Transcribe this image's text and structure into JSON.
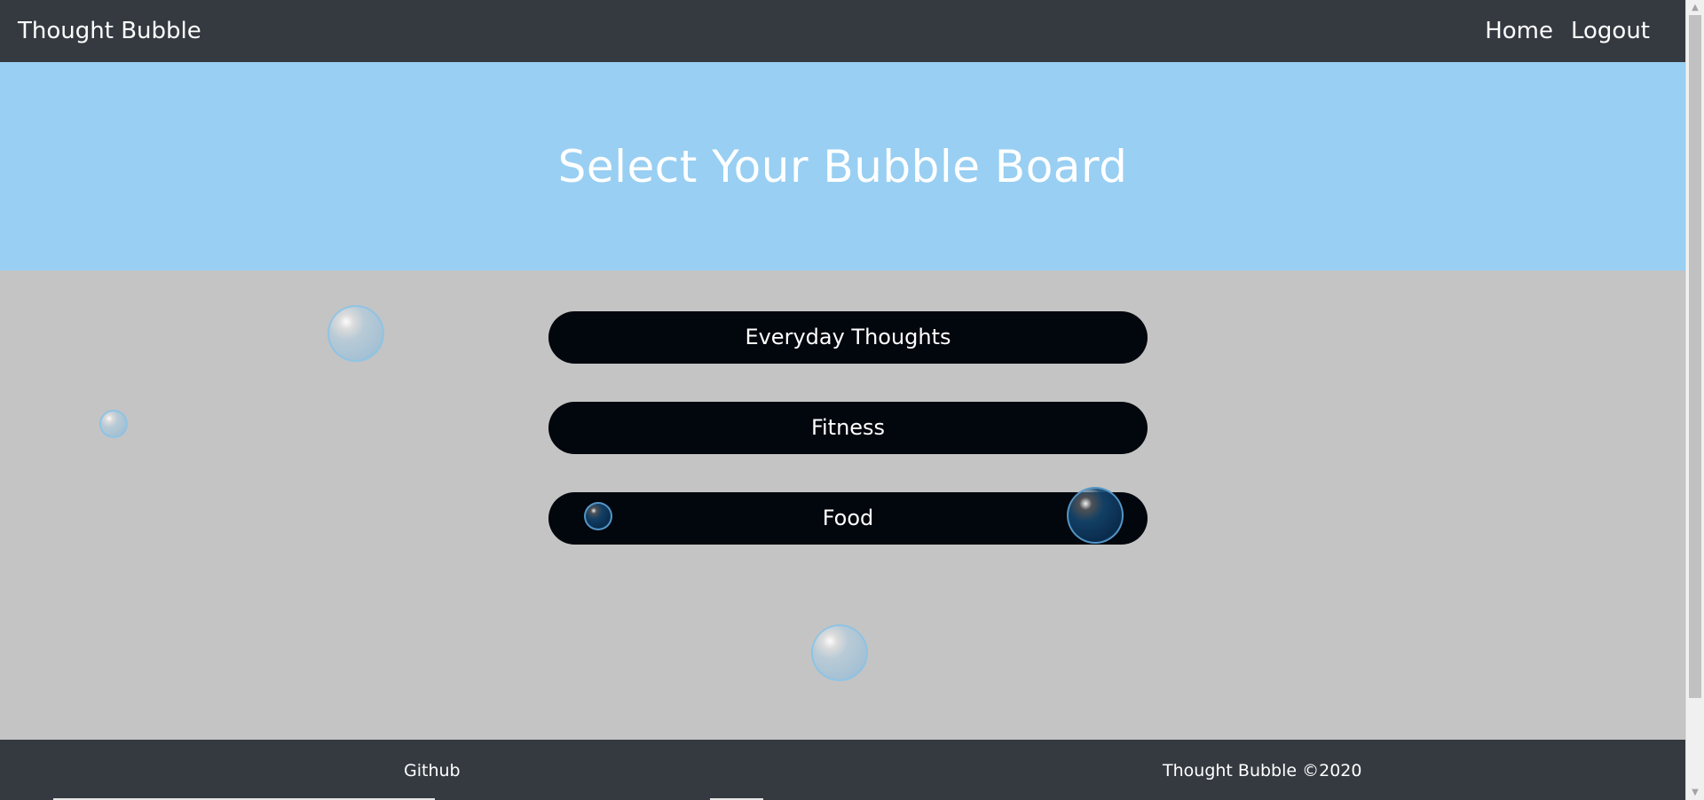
{
  "navbar": {
    "brand": "Thought Bubble",
    "links": [
      "Home",
      "Logout"
    ]
  },
  "hero": {
    "title": "Select Your Bubble Board"
  },
  "boards": [
    "Everyday Thoughts",
    "Fitness",
    "Food"
  ],
  "footer": {
    "github": "Github",
    "copyright": "Thought Bubble ©2020"
  },
  "colors": {
    "navbar_bg": "#343a40",
    "hero_bg": "#99cff2",
    "body_bg": "#c4c4c4",
    "button_bg": "#02060d",
    "text": "#ffffff"
  },
  "icons": {
    "scroll_up": "scroll-up-arrow-icon",
    "scroll_down": "scroll-down-arrow-icon",
    "bubble": "bubble-icon"
  }
}
